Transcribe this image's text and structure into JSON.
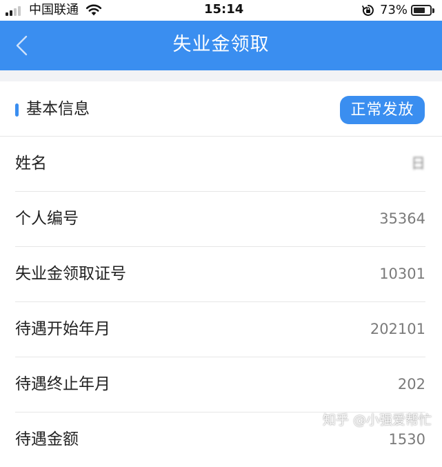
{
  "status_bar": {
    "carrier": "中国联通",
    "time": "15:14",
    "battery_percent": "73%",
    "battery_level": 0.73,
    "icons": [
      "signal-icon",
      "wifi-icon",
      "rotation-lock-icon",
      "battery-icon"
    ]
  },
  "nav": {
    "title": "失业金领取",
    "back_icon": "chevron-left-icon"
  },
  "section": {
    "title": "基本信息",
    "status": "正常发放"
  },
  "rows": [
    {
      "label": "姓名",
      "value": "日"
    },
    {
      "label": "个人编号",
      "value": "35364"
    },
    {
      "label": "失业金领取证号",
      "value": "10301"
    },
    {
      "label": "待遇开始年月",
      "value": "202101"
    },
    {
      "label": "待遇终止年月",
      "value": "202"
    },
    {
      "label": "待遇金额",
      "value": "1530"
    }
  ],
  "watermark": "知乎 @小强爱帮忙",
  "colors": {
    "accent": "#3a8ef0",
    "divider": "#e6e6e6",
    "label_text": "#222222",
    "value_text": "#7a7a7a"
  }
}
